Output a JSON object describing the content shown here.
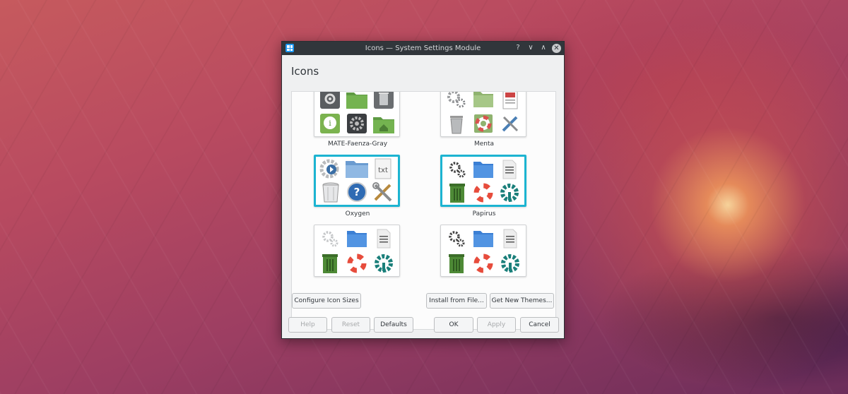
{
  "window": {
    "title": "Icons — System Settings Module",
    "help_glyph": "?",
    "minimize_glyph": "∨",
    "maximize_glyph": "∧",
    "close_glyph": "✕"
  },
  "heading": "Icons",
  "themes": [
    {
      "name": "MATE-Faenza-Gray",
      "selected": false,
      "icons": [
        "gear-icon",
        "folder-icon",
        "trash-icon",
        "info-chat-icon",
        "settings-icon",
        "home-folder-icon"
      ]
    },
    {
      "name": "Menta",
      "selected": false,
      "icons": [
        "gears-icon",
        "folder-icon",
        "document-icon",
        "trash-icon",
        "lifebuoy-icon",
        "tools-icon"
      ]
    },
    {
      "name": "Oxygen",
      "selected": true,
      "icons": [
        "media-settings-icon",
        "folder-icon",
        "text-file-icon",
        "trash-icon",
        "help-icon",
        "tools-icon"
      ]
    },
    {
      "name": "Papirus",
      "selected": true,
      "icons": [
        "gears-icon",
        "folder-icon",
        "document-icon",
        "trash-icon",
        "lifebuoy-icon",
        "settings-icon"
      ]
    },
    {
      "name": "",
      "selected": false,
      "icons": [
        "gears-icon",
        "folder-icon",
        "document-icon",
        "trash-icon",
        "lifebuoy-icon",
        "settings-icon"
      ]
    },
    {
      "name": "",
      "selected": false,
      "icons": [
        "gears-icon",
        "folder-icon",
        "document-icon",
        "trash-icon",
        "lifebuoy-icon",
        "settings-icon"
      ]
    }
  ],
  "buttons": {
    "configure_sizes": "Configure Icon Sizes",
    "install_from_file": "Install from File...",
    "get_new_themes": "Get New Themes...",
    "help": "Help",
    "reset": "Reset",
    "defaults": "Defaults",
    "ok": "OK",
    "apply": "Apply",
    "cancel": "Cancel"
  },
  "colors": {
    "selection": "#1cb4d1",
    "titlebar": "#31363b",
    "window_bg": "#eff0f1"
  }
}
